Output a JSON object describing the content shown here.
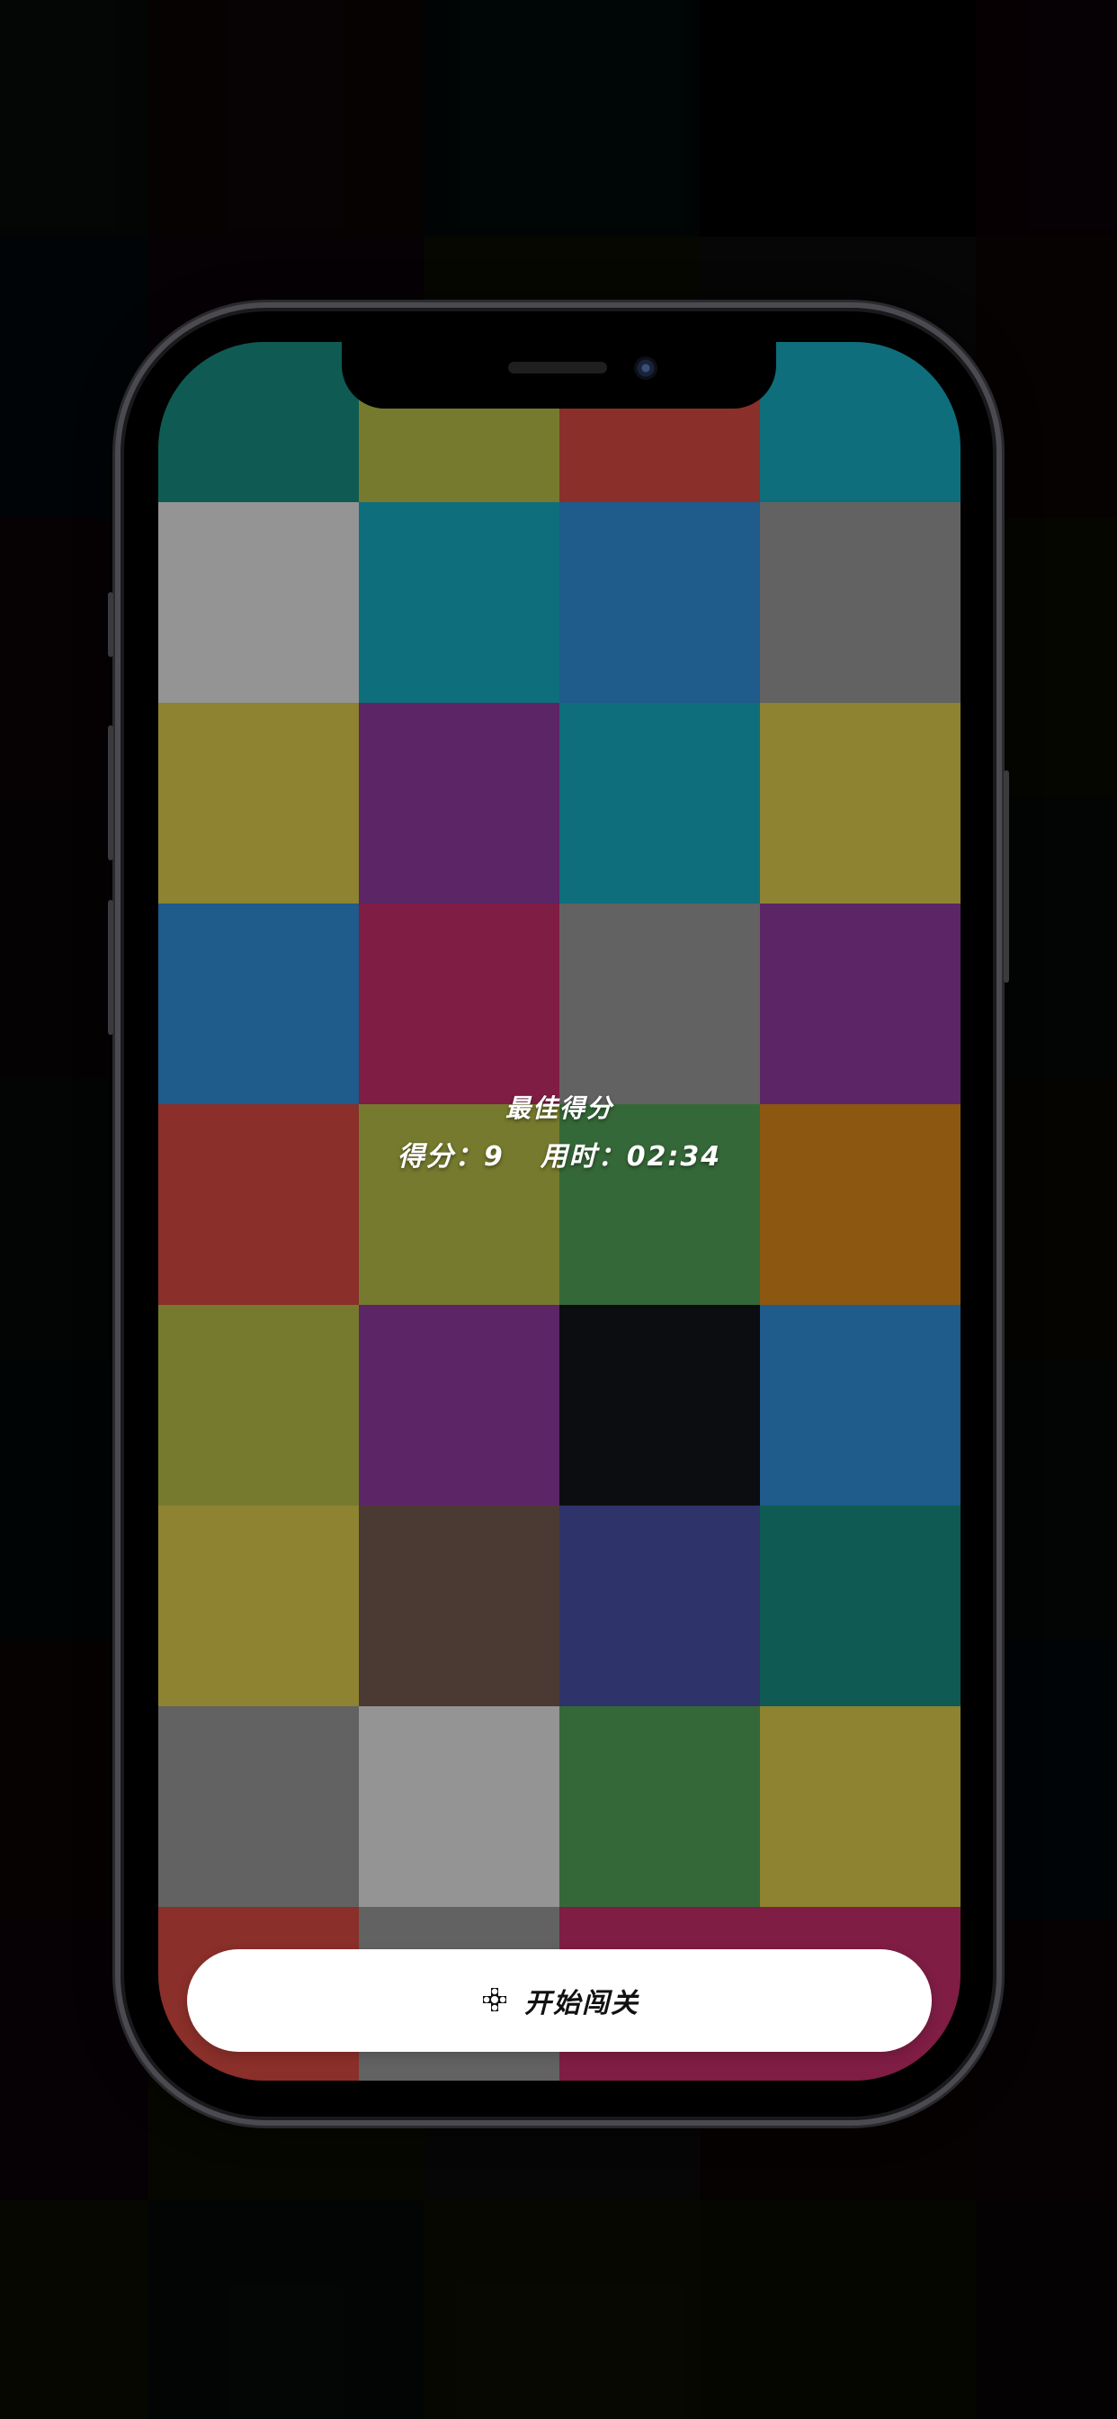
{
  "background_palette": [
    "#0f1a12",
    "#1e0a0c",
    "#02161a",
    "#000000",
    "#1c0410",
    "#02131d",
    "#1c0818",
    "#212205",
    "#1c1c1c",
    "#200a0a",
    "#1c0914",
    "#21210a",
    "#0c1a10",
    "#202306",
    "#1c1c06",
    "#120a0e",
    "#200a0a",
    "#1c1c06",
    "#141414",
    "#0c1a10",
    "#0c1a10",
    "#201c06",
    "#1c0414",
    "#02161a",
    "#1e1506",
    "#041414",
    "#041414",
    "#1c0410",
    "#0c0c1a"
  ],
  "tile_colors": [
    [
      "#0f5b53",
      "#767a2e",
      "#8a2f2a",
      "#0f6e7b"
    ],
    [
      "#949494",
      "#0f6e7b",
      "#1f5b8b",
      "#626262"
    ],
    [
      "#8d8330",
      "#5c2566",
      "#0f6e7b",
      "#8d8330"
    ],
    [
      "#1f5b8b",
      "#7f1d44",
      "#626262",
      "#5c2566"
    ],
    [
      "#8a2f2a",
      "#767a2e",
      "#356838",
      "#8b5711"
    ],
    [
      "#767a2e",
      "#5c2566",
      "#0c0d10",
      "#1f5b8b"
    ],
    [
      "#8d8330",
      "#4a3a33",
      "#2e336a",
      "#0f5b53"
    ],
    [
      "#626262",
      "#949494",
      "#356838",
      "#8d8330"
    ],
    [
      "#8a2f2a",
      "#626262",
      "#7f1d44",
      "#7f1d44"
    ]
  ],
  "score": {
    "best_title": "最佳得分",
    "score_label": "得分：",
    "score_value": "9",
    "time_label": "用时：",
    "time_value": "02:34"
  },
  "start_button": {
    "icon": "gamepad-icon",
    "label": "开始闯关"
  }
}
